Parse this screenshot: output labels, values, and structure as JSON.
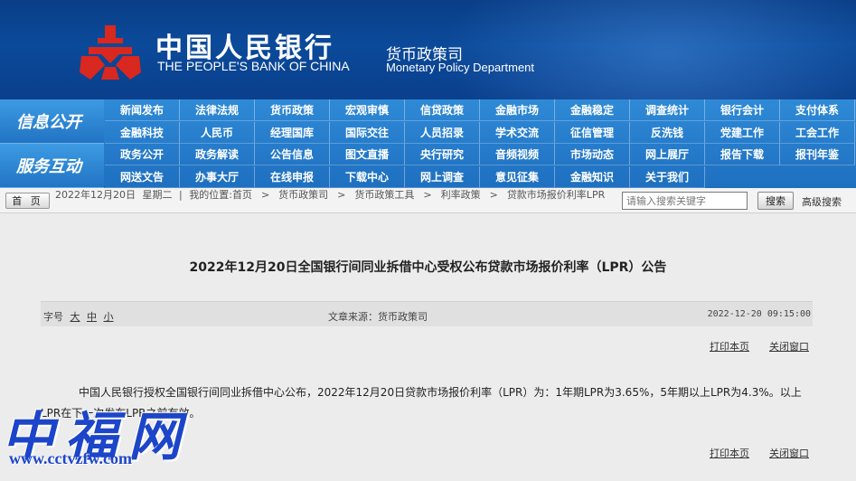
{
  "header": {
    "bank_cn": "中国人民银行",
    "bank_en": "THE PEOPLE'S BANK OF CHINA",
    "dept_cn": "货币政策司",
    "dept_en": "Monetary Policy Department",
    "brand_red": "#d8281f",
    "brand_blue": "#0b4a9a"
  },
  "nav": {
    "section1_label": "信息公开",
    "section2_label": "服务互动",
    "rows": [
      [
        "新闻发布",
        "法律法规",
        "货币政策",
        "宏观审慎",
        "信贷政策",
        "金融市场",
        "金融稳定",
        "调查统计",
        "银行会计",
        "支付体系"
      ],
      [
        "金融科技",
        "人民币",
        "经理国库",
        "国际交往",
        "人员招录",
        "学术交流",
        "征信管理",
        "反洗钱",
        "党建工作",
        "工会工作"
      ],
      [
        "政务公开",
        "政务解读",
        "公告信息",
        "图文直播",
        "央行研究",
        "音频视频",
        "市场动态",
        "网上展厅",
        "报告下载",
        "报刊年鉴"
      ],
      [
        "网送文告",
        "办事大厅",
        "在线申报",
        "下载中心",
        "网上调查",
        "意见征集",
        "金融知识",
        "关于我们"
      ]
    ]
  },
  "breadcrumb": {
    "home_label": "首 页",
    "date": "2022年12月20日",
    "weekday": "星期二",
    "location_prefix": "我的位置:",
    "items": [
      "首页",
      "货币政策司",
      "货币政策工具",
      "利率政策",
      "贷款市场报价利率LPR"
    ],
    "separator": ">"
  },
  "search": {
    "placeholder": "请输入搜索关键字",
    "button_label": "搜索",
    "advanced_label": "高级搜索"
  },
  "article": {
    "title": "2022年12月20日全国银行间同业拆借中心受权公布贷款市场报价利率（LPR）公告",
    "font_size_label": "字号",
    "font_sizes": [
      "大",
      "中",
      "小"
    ],
    "source": "文章来源：货币政策司",
    "publish_time": "2022-12-20 09:15:00",
    "print_label": "打印本页",
    "close_label": "关闭窗口",
    "body": "中国人民银行授权全国银行间同业拆借中心公布，2022年12月20日贷款市场报价利率（LPR）为：1年期LPR为3.65%，5年期以上LPR为4.3%。以上LPR在下一次发布LPR之前有效。"
  },
  "watermark": {
    "site_name": "中福网",
    "url": "www.cctvzfw.com",
    "color": "#1c45c9"
  }
}
